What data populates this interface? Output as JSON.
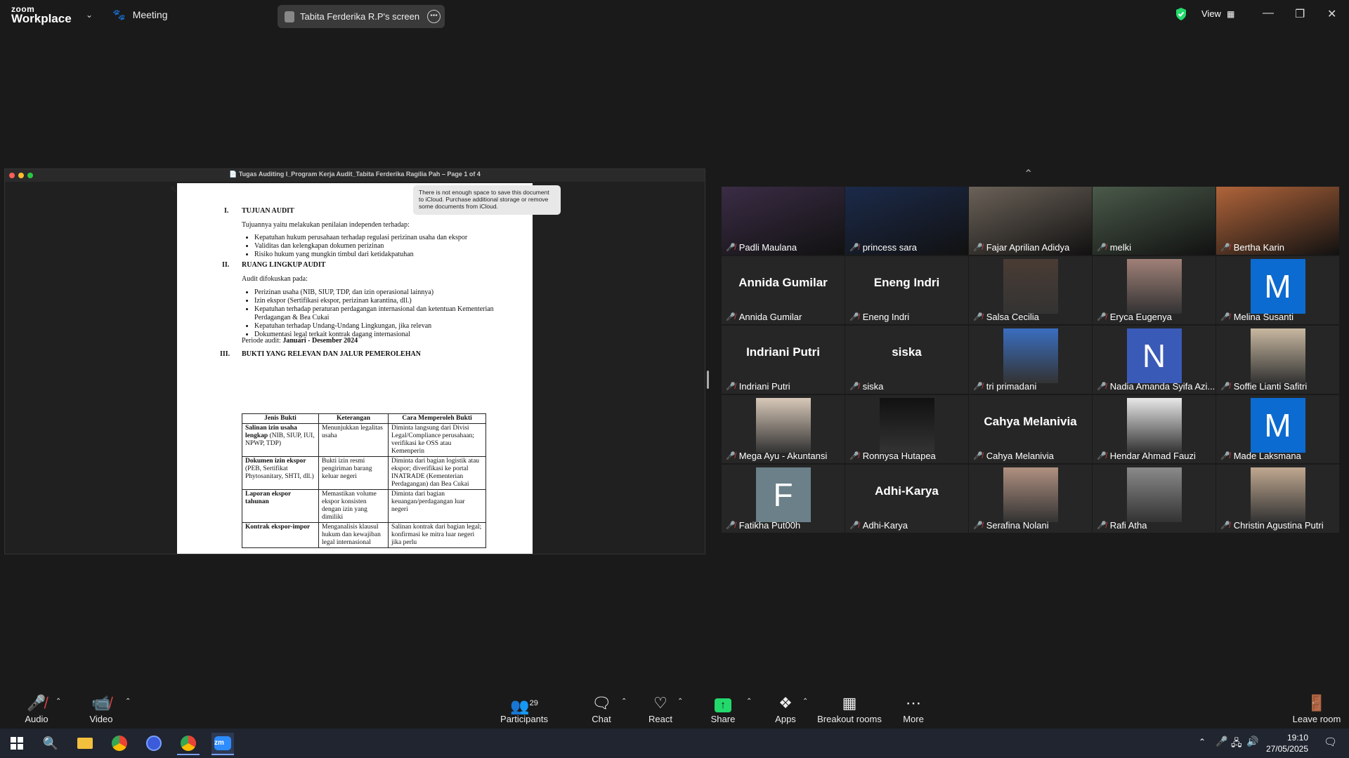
{
  "app": {
    "brand_top": "zoom",
    "brand_bottom": "Workplace",
    "meeting_label": "Meeting",
    "screen_share_label": "Tabita Ferderika R.P's screen",
    "view_label": "View"
  },
  "shared_doc": {
    "title": "Tugas Auditing I_Program Kerja Audit_Tabita Ferderika Ragilia Pah – Page 1 of 4",
    "tooltip": "There is not enough space to save this document to iCloud. Purchase additional storage or remove some documents from iCloud.",
    "sec1_num": "I.",
    "sec1_title": "TUJUAN AUDIT",
    "sec1_intro": "Tujuannya yaitu melakukan penilaian independen terhadap:",
    "sec1_items": [
      "Kepatuhan hukum perusahaan terhadap regulasi perizinan usaha dan ekspor",
      "Validitas dan kelengkapan dokumen perizinan",
      "Risiko hukum yang mungkin timbul dari ketidakpatuhan"
    ],
    "sec2_num": "II.",
    "sec2_title": "RUANG LINGKUP AUDIT",
    "sec2_intro": "Audit difokuskan pada:",
    "sec2_items": [
      "Perizinan usaha (NIB, SIUP, TDP, dan izin operasional lainnya)",
      "Izin ekspor (Sertifikasi ekspor, perizinan karantina, dll.)",
      "Kepatuhan terhadap peraturan perdagangan internasional dan ketentuan Kementerian Perdagangan & Bea Cukai",
      "Kepatuhan terhadap Undang-Undang Lingkungan, jika relevan",
      "Dokumentasi legal terkait kontrak dagang internasional"
    ],
    "period_label": "Periode audit:",
    "period_value": "Januari - Desember 2024",
    "sec3_num": "III.",
    "sec3_title": "BUKTI YANG RELEVAN DAN JALUR PEMEROLEHAN",
    "table_headers": [
      "Jenis Bukti",
      "Keterangan",
      "Cara Memperoleh Bukti"
    ],
    "table_rows": [
      {
        "bold": "Salinan izin usaha lengkap",
        "rest": " (NIB, SIUP, IUI, NPWP, TDP)",
        "ket": "Menunjukkan legalitas usaha",
        "cara": "Diminta langsung dari Divisi Legal/Compliance perusahaan; verifikasi ke OSS atau Kemenperin"
      },
      {
        "bold": "Dokumen izin ekspor",
        "rest": " (PEB, Sertifikat Phytosanitary, SHTI, dll.)",
        "ket": "Bukti izin resmi pengiriman barang keluar negeri",
        "cara": "Diminta dari bagian logistik atau ekspor; diverifikasi ke portal INATRADE (Kementerian Perdagangan) dan Bea Cukai"
      },
      {
        "bold": "Laporan ekspor tahunan",
        "rest": "",
        "ket": "Memastikan volume ekspor konsisten dengan izin yang dimiliki",
        "cara": "Diminta dari bagian keuangan/perdagangan luar negeri"
      },
      {
        "bold": "Kontrak ekspor-impor",
        "rest": "",
        "ket": "Menganalisis klausul hukum dan kewajiban legal internasional",
        "cara": "Salinan kontrak dari bagian legal; konfirmasi ke mitra luar negeri jika perlu"
      }
    ]
  },
  "participants": [
    {
      "name": "Padli Maulana",
      "kind": "video",
      "bg": "#3a2c45"
    },
    {
      "name": "princess sara",
      "kind": "video",
      "bg": "#1b2a4a"
    },
    {
      "name": "Fajar Aprilian Adidya",
      "kind": "video",
      "bg": "#6b6258"
    },
    {
      "name": "melki",
      "kind": "video",
      "bg": "#4a5a4a",
      "active": true
    },
    {
      "name": "Bertha Karin",
      "kind": "video",
      "bg": "#b0643a"
    },
    {
      "name": "Annida Gumilar",
      "kind": "text",
      "display": "Annida Gumilar"
    },
    {
      "name": "Eneng Indri",
      "kind": "text",
      "display": "Eneng Indri"
    },
    {
      "name": "Salsa Cecilia",
      "kind": "photo",
      "bg": "#4a3c34"
    },
    {
      "name": "Eryca Eugenya",
      "kind": "photo",
      "bg": "#a08078"
    },
    {
      "name": "Melina Susanti",
      "kind": "letter",
      "letter": "M",
      "bg": "#0c6bd0"
    },
    {
      "name": "Indriani Putri",
      "kind": "text",
      "display": "Indriani Putri"
    },
    {
      "name": "siska",
      "kind": "text",
      "display": "siska"
    },
    {
      "name": "tri primadani",
      "kind": "photo",
      "bg": "#3a6ec0"
    },
    {
      "name": "Nadia Amanda Syifa Azi...",
      "kind": "letter",
      "letter": "N",
      "bg": "#3a5ab8"
    },
    {
      "name": "Soffie Lianti Safitri",
      "kind": "photo",
      "bg": "#c8b8a0"
    },
    {
      "name": "Mega Ayu - Akuntansi",
      "kind": "photo",
      "bg": "#d8c8b8"
    },
    {
      "name": "Ronnysa Hutapea",
      "kind": "photo",
      "bg": "#111111"
    },
    {
      "name": "Cahya Melanivia",
      "kind": "text",
      "display": "Cahya Melanivia"
    },
    {
      "name": "Hendar Ahmad Fauzi",
      "kind": "photo",
      "bg": "#e8e8e8"
    },
    {
      "name": "Made Laksmana",
      "kind": "letter",
      "letter": "M",
      "bg": "#0c6bd0"
    },
    {
      "name": "Fatikha Put00h",
      "kind": "letter",
      "letter": "F",
      "bg": "#6b8088"
    },
    {
      "name": "Adhi-Karya",
      "kind": "text",
      "display": "Adhi-Karya"
    },
    {
      "name": "Serafina Nolani",
      "kind": "photo",
      "bg": "#b09080"
    },
    {
      "name": "Rafi Atha",
      "kind": "photo",
      "bg": "#8a8a8a"
    },
    {
      "name": "Christin Agustina Putri",
      "kind": "photo",
      "bg": "#c0a890"
    }
  ],
  "toolbar": {
    "audio": "Audio",
    "video": "Video",
    "participants": "Participants",
    "participants_count": "29",
    "chat": "Chat",
    "react": "React",
    "share": "Share",
    "apps": "Apps",
    "breakout": "Breakout rooms",
    "more": "More",
    "leave": "Leave room"
  },
  "taskbar": {
    "time": "19:10",
    "date": "27/05/2025"
  },
  "colors": {
    "accent_green": "#23d96c",
    "share_green": "#23d96c",
    "muted_red": "#e04545"
  }
}
